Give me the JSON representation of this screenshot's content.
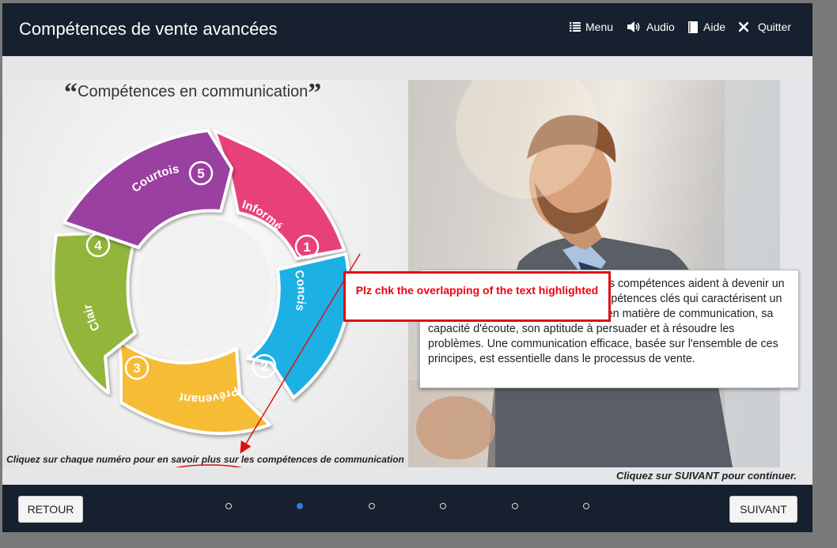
{
  "header": {
    "title": "Compétences de vente avancées",
    "nav": [
      {
        "label": "Menu",
        "icon": "list-icon"
      },
      {
        "label": "Audio",
        "icon": "speaker-icon"
      },
      {
        "label": "Aide",
        "icon": "book-icon"
      },
      {
        "label": "Quitter",
        "icon": "close-icon"
      }
    ]
  },
  "slide": {
    "title": "Compétences en communication",
    "cycle": [
      {
        "number": "1",
        "label": "Informé",
        "color": "#e8407a"
      },
      {
        "number": "2",
        "label": "Concis",
        "color": "#1bb0e4"
      },
      {
        "number": "3",
        "label": "Prévenant",
        "color": "#f6bc34"
      },
      {
        "number": "4",
        "label": "Clair",
        "color": "#92b53a"
      },
      {
        "number": "5",
        "label": "Courtois",
        "color": "#9a3fa0"
      }
    ],
    "instruction": "Cliquez sur chaque numéro pour en savoir plus sur les compétences de communication essentielles.",
    "body_text": "Découvrons maintenant comment les compétences aident à devenir un vendeur performant. Les quatre compétences clés qui caractérisent un bon vendeur asont les compétencs en matière de communication, sa capacité d'écoute, son aptitude à persuader et à résoudre les problèmes. Une communication efficace, basée sur l'ensemble de ces principes, est essentielle dans le processus de vente.",
    "next_hint": "Cliquez sur SUIVANT pour continuer."
  },
  "annotation": {
    "text": "Plz chk the overlapping of the text highlighted",
    "color": "#dd1111"
  },
  "footer": {
    "back_label": "RETOUR",
    "next_label": "SUIVANT",
    "pages_total": 6,
    "current_page": 2
  },
  "colors": {
    "header_bg": "#16202e",
    "active_dot": "#2b7fd8"
  }
}
